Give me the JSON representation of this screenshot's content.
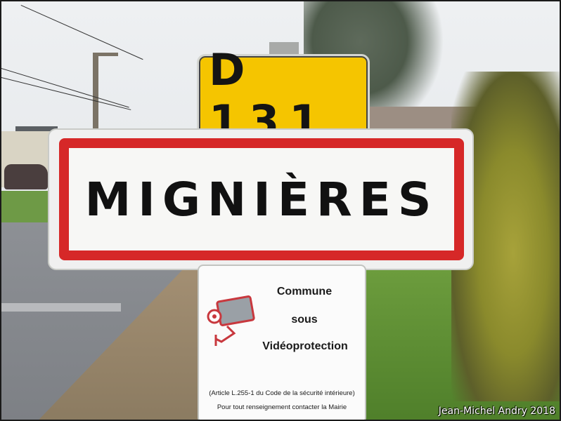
{
  "route_sign": {
    "text": "D 131",
    "background": "#f5c500",
    "text_color": "#141414"
  },
  "town_sign": {
    "name": "MIGNIÈRES",
    "border_color": "#d62828"
  },
  "info_sign": {
    "icon": "cctv-camera-icon",
    "line1": "Commune",
    "line2": "sous",
    "line3": "Vidéoprotection",
    "small1": "(Article L.255-1 du Code de la sécurité intérieure)",
    "small2": "Pour tout renseignement contacter la Mairie"
  },
  "credit": "Jean-Michel Andry 2018"
}
